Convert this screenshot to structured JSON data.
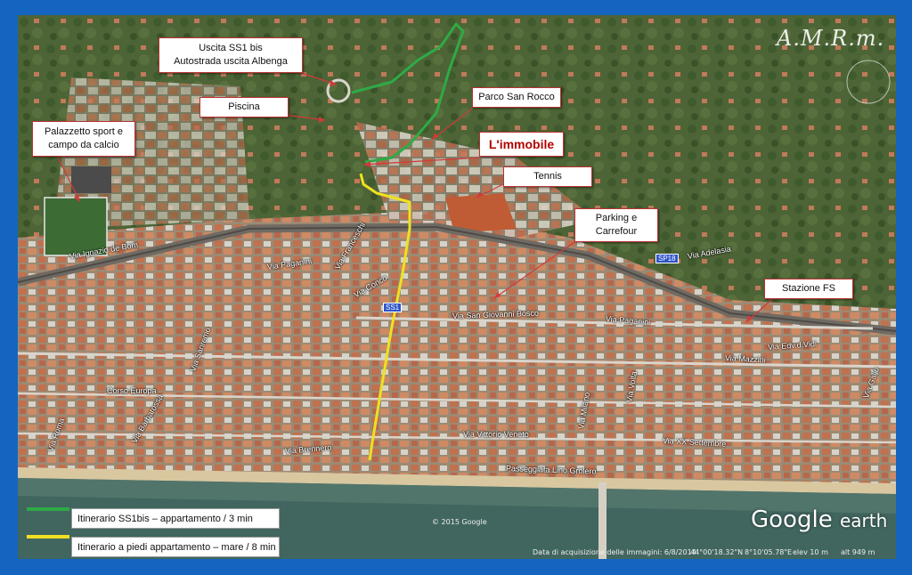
{
  "watermark": "A.M.R.m.",
  "labels": {
    "ss1": "Uscita SS1 bis\nAutostrada uscita Albenga",
    "piscina": "Piscina",
    "palazzetto": "Palazzetto sport e\ncampo da calcio",
    "parco": "Parco San Rocco",
    "immobile": "L'immobile",
    "tennis": "Tennis",
    "parking": "Parking e\nCarrefour",
    "stazione": "Stazione FS"
  },
  "streets": {
    "ignazio": "Via Ignazio de Bom",
    "paganini": "Via Paganini",
    "franceschi": "Via Franceschi",
    "concordia": "Via Conco",
    "paganini2": "Via Paganini",
    "sangiovanni": "Via San Giovanni Bosco",
    "adelasia": "Via Adelasia",
    "edvi": "Via Edv.d.Vidi",
    "mazzini": "Via Mazzini",
    "europa": "Corso Europa",
    "sanremo": "Via Sanremo",
    "vittorioveneto": "Via Vittorio Veneto",
    "xxsettembre": "Via XX Settembre",
    "brennero": "Via Brennero",
    "passeggiata": "Passeggiata Lino Grolero",
    "roma": "Via Roma",
    "gallo": "Via Gallo",
    "milano": "Via Milano",
    "volta": "Via Volta",
    "barbarossa": "Via Barbarossa"
  },
  "shields": {
    "ss1": "SS1",
    "sp18": "SP18"
  },
  "legend": [
    {
      "color": "#2faa46",
      "text": "Itinerario SS1bis – appartamento  /  3 min"
    },
    {
      "color": "#f0e020",
      "text": "Itinerario a piedi appartamento – mare  /  8 min"
    }
  ],
  "copyright": "© 2015 Google",
  "logo": {
    "main": "Google",
    "sub": "earth"
  },
  "status": {
    "date": "Data di acquisizione delle immagini: 6/8/2014",
    "lat": "44°00'18.32\"N",
    "lon": "8°10'05.78\"E",
    "elev": "elev   10 m",
    "alt": "alt   949 m"
  },
  "colors": {
    "walk_route": "#f0e020",
    "drive_route": "#2faa46",
    "frame": "#1565c0",
    "label_border": "#b33"
  }
}
